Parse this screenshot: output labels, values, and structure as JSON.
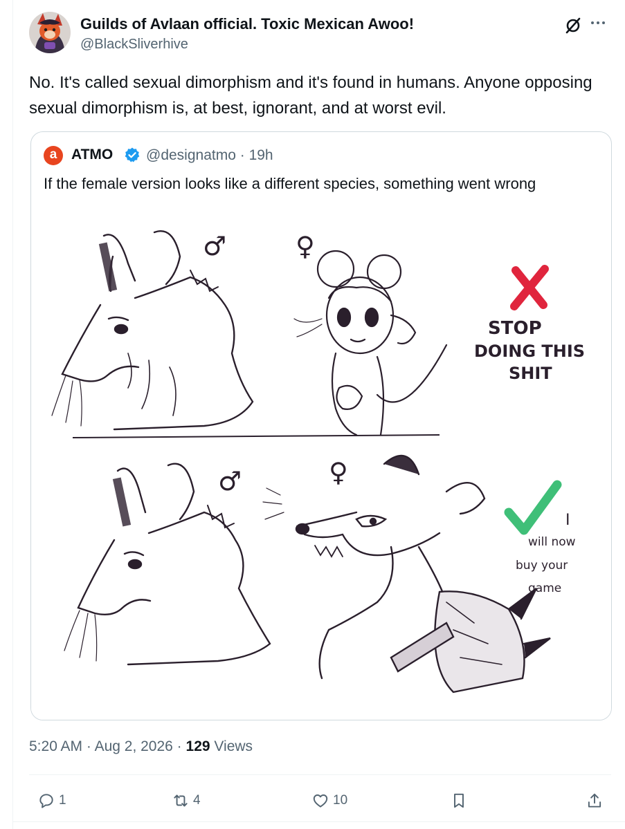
{
  "tweet": {
    "author_name": "Guilds of Avlaan official. Toxic Mexican Awoo!",
    "author_handle": "@BlackSliverhive",
    "text": "No. It's called sexual dimorphism and it's found in humans. Anyone opposing sexual dimorphism is, at best, ignorant, and at worst evil.",
    "time": "5:20 AM",
    "date": "Aug 2, 2026",
    "views_count": "129",
    "views_label": "Views"
  },
  "quote": {
    "avatar_letter": "a",
    "author_name": "ATMO",
    "author_handle": "@designatmo",
    "age": "19h",
    "text": "If the female version looks like a different species, something went wrong",
    "image": {
      "top_male_symbol": "♂",
      "top_female_symbol": "♀",
      "bottom_male_symbol": "♂",
      "bottom_female_symbol": "♀",
      "top_caption": [
        "STOP",
        "DOING THIS",
        "SHIT"
      ],
      "bottom_caption": [
        "I",
        "will now",
        "buy your",
        "game"
      ]
    }
  },
  "actions": {
    "replies": "1",
    "reposts": "4",
    "likes": "10"
  },
  "colors": {
    "accent_red": "#e0253d",
    "accent_green": "#3fbf78",
    "verified_blue": "#1d9bf0",
    "atmo_orange": "#e8451f"
  }
}
